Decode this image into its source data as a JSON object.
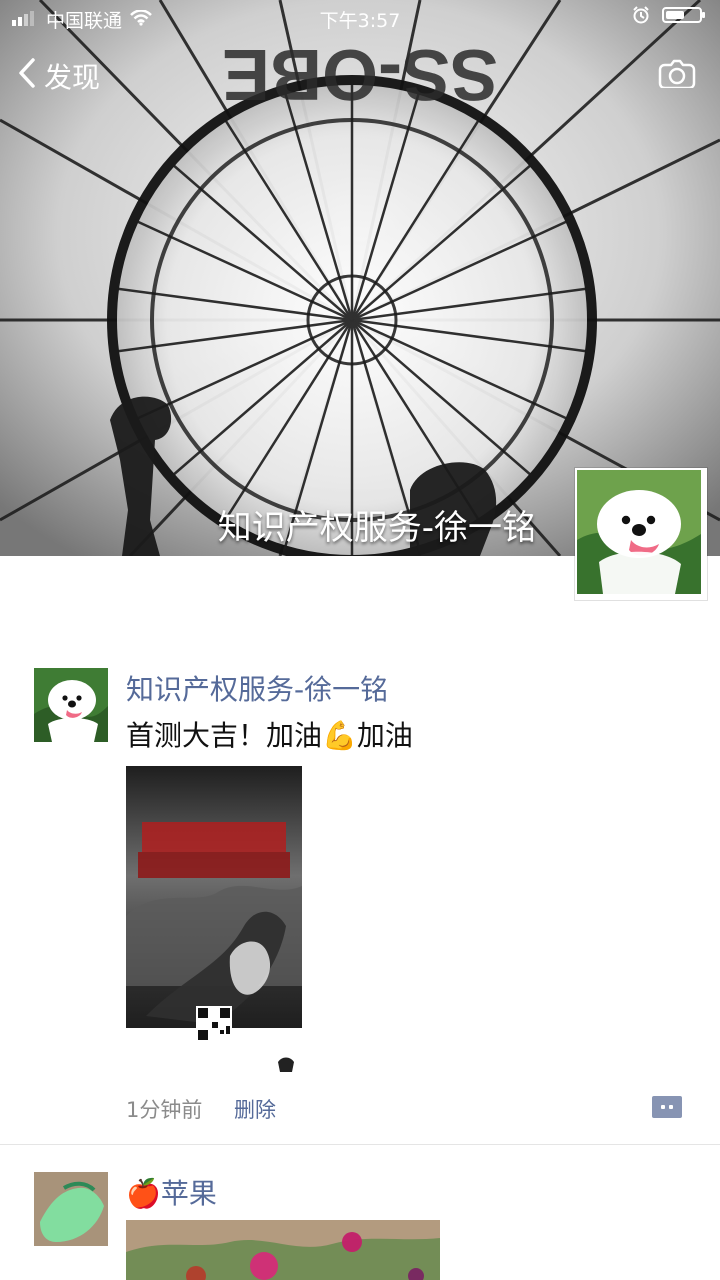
{
  "status": {
    "carrier": "中国联通",
    "time": "下午3:57"
  },
  "nav": {
    "back_label": "发现"
  },
  "profile": {
    "name": "知识产权服务-徐一铭"
  },
  "cover": {
    "balloon_text": "SS-OBE"
  },
  "posts": [
    {
      "author": "知识产权服务-徐一铭",
      "text": "首测大吉！加油💪加油",
      "time": "1分钟前",
      "delete_label": "删除"
    },
    {
      "author": "🍎苹果"
    }
  ],
  "colors": {
    "link_blue": "#556a99",
    "meta_gray": "#8b8b8b"
  }
}
